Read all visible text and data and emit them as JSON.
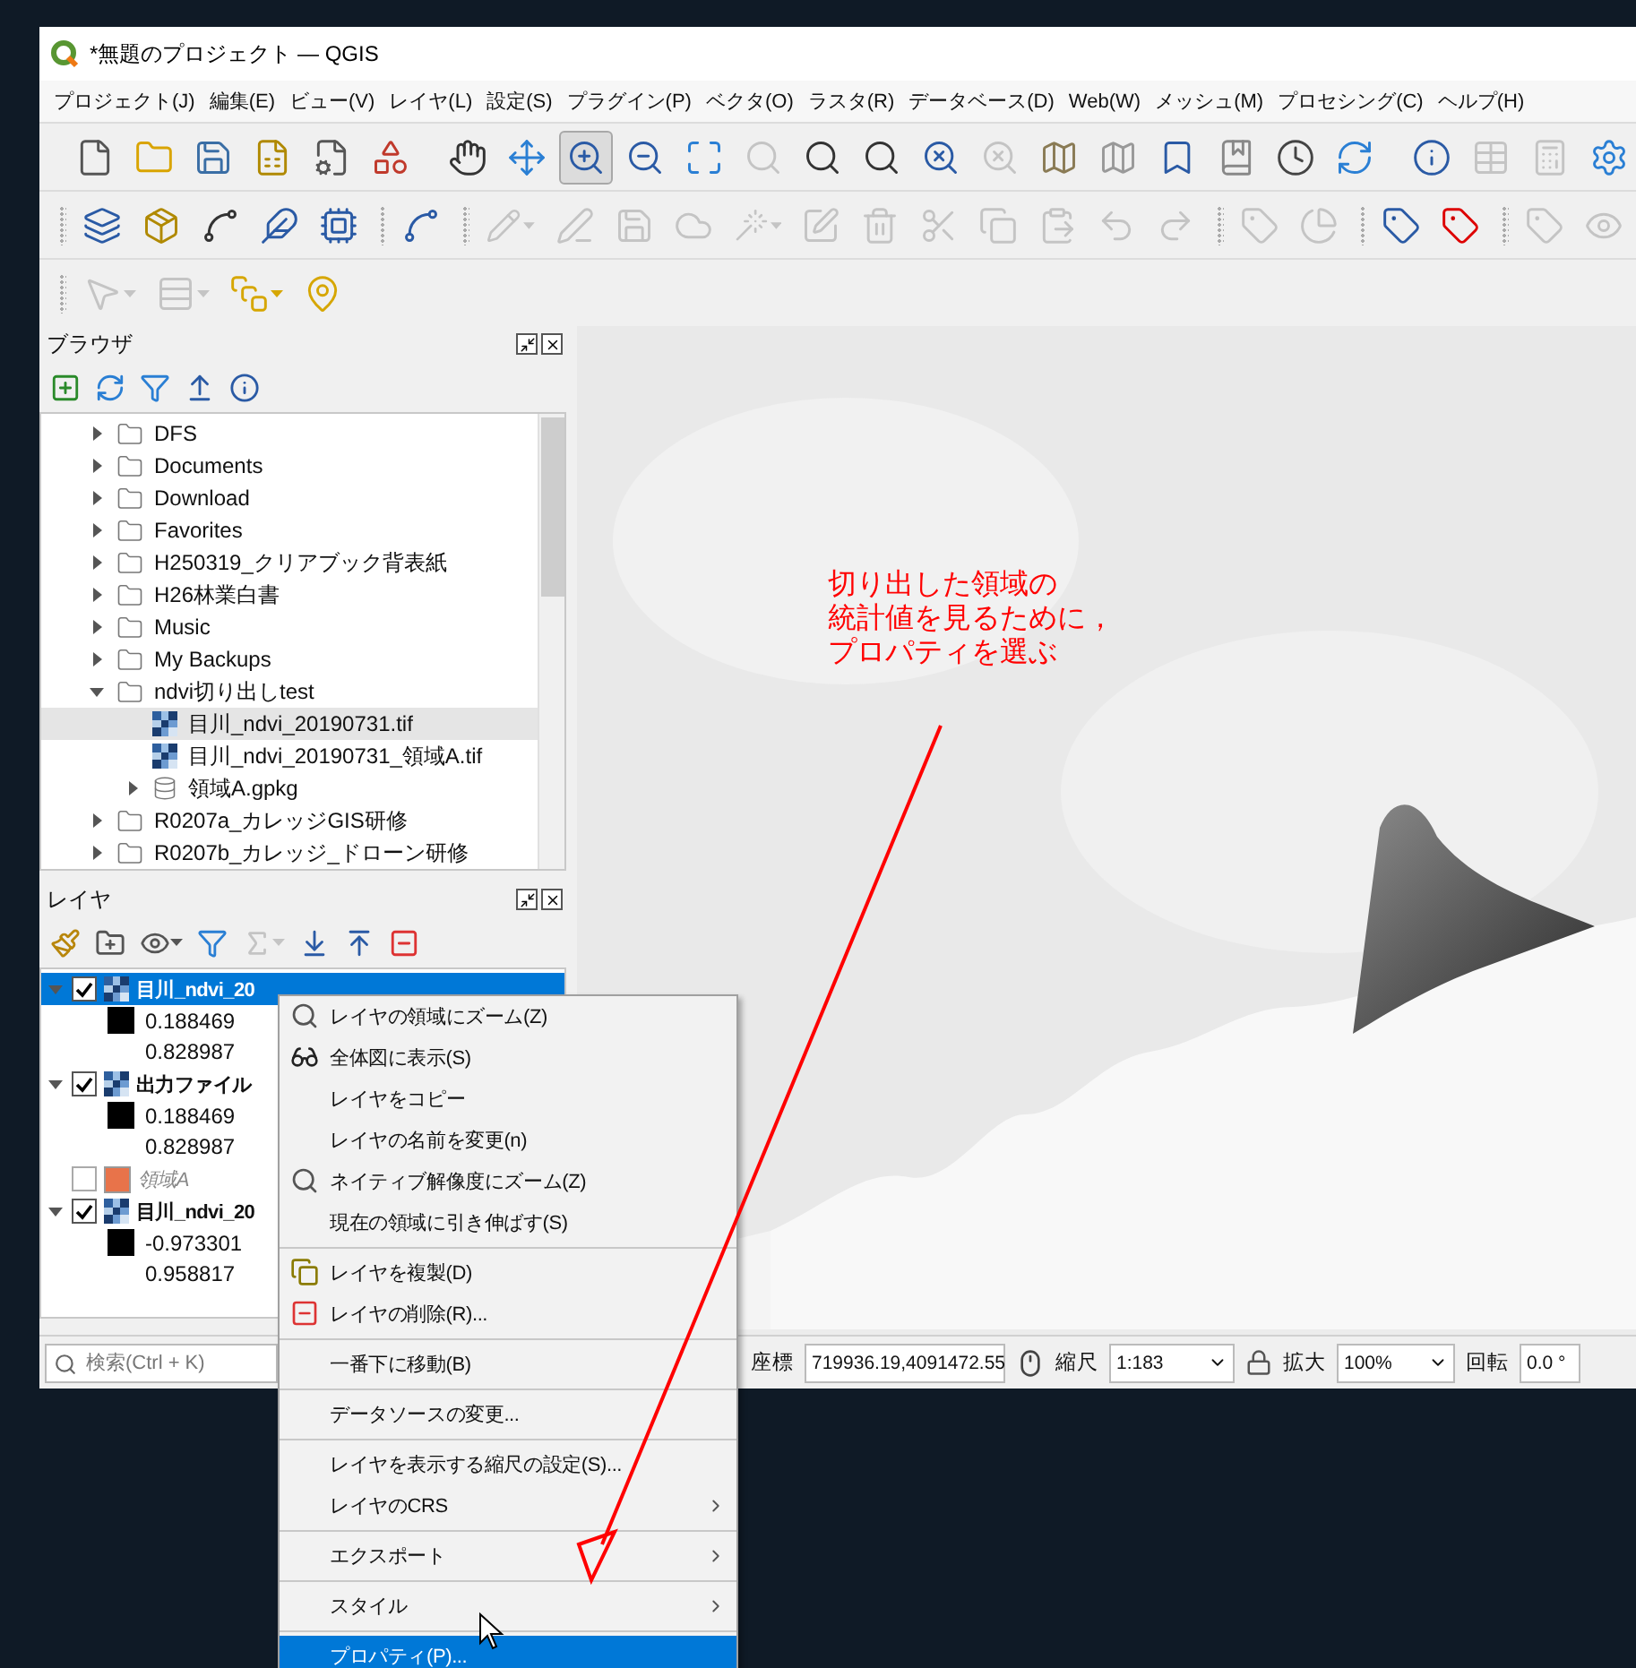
{
  "window": {
    "title": "*無題のプロジェクト — QGIS"
  },
  "menu_bar": [
    "プロジェクト(J)",
    "編集(E)",
    "ビュー(V)",
    "レイヤ(L)",
    "設定(S)",
    "プラグイン(P)",
    "ベクタ(O)",
    "ラスタ(R)",
    "データベース(D)",
    "Web(W)",
    "メッシュ(M)",
    "プロセシング(C)",
    "ヘルプ(H)"
  ],
  "toolbars": [
    {
      "buttons": [
        {
          "disabled": false,
          "selected": false
        },
        {
          "disabled": false,
          "selected": false
        },
        {
          "disabled": false,
          "selected": false
        },
        {
          "disabled": false,
          "selected": false
        },
        {
          "disabled": false,
          "selected": false
        },
        {
          "disabled": false,
          "selected": false
        },
        {
          "disabled": false,
          "selected": false
        },
        {
          "disabled": false,
          "selected": false
        },
        {
          "disabled": false,
          "selected": true
        },
        {
          "disabled": false,
          "selected": false
        },
        {
          "disabled": false,
          "selected": false
        },
        {
          "disabled": true,
          "selected": false
        },
        {
          "disabled": false,
          "selected": false
        },
        {
          "disabled": false,
          "selected": false
        },
        {
          "disabled": false,
          "selected": false
        },
        {
          "disabled": true,
          "selected": false
        },
        {
          "disabled": false,
          "selected": false
        },
        {
          "disabled": false,
          "selected": false
        },
        {
          "disabled": false,
          "selected": false
        },
        {
          "disabled": false,
          "selected": false
        },
        {
          "disabled": false,
          "selected": false
        },
        {
          "disabled": false,
          "selected": false
        },
        {
          "disabled": false,
          "selected": false
        },
        {
          "disabled": true,
          "selected": false
        },
        {
          "disabled": true,
          "selected": false
        },
        {
          "disabled": false,
          "selected": false
        }
      ]
    },
    {
      "buttons": [
        {
          "disabled": false,
          "selected": false
        },
        {
          "disabled": false,
          "selected": false
        },
        {
          "disabled": false,
          "selected": false
        },
        {
          "disabled": false,
          "selected": false
        },
        {
          "disabled": false,
          "selected": false
        },
        {
          "disabled": false,
          "selected": false
        },
        {
          "disabled": true,
          "selected": false
        },
        {
          "disabled": true,
          "selected": false
        },
        {
          "disabled": true,
          "selected": false
        },
        {
          "disabled": true,
          "selected": false
        },
        {
          "disabled": true,
          "selected": false
        },
        {
          "disabled": true,
          "selected": false
        },
        {
          "disabled": true,
          "selected": false
        },
        {
          "disabled": true,
          "selected": false
        },
        {
          "disabled": true,
          "selected": false
        },
        {
          "disabled": true,
          "selected": false
        },
        {
          "disabled": true,
          "selected": false
        },
        {
          "disabled": true,
          "selected": false
        },
        {
          "disabled": true,
          "selected": false
        },
        {
          "disabled": true,
          "selected": false
        },
        {
          "disabled": false,
          "selected": false
        },
        {
          "disabled": false,
          "selected": false
        },
        {
          "disabled": true,
          "selected": false
        },
        {
          "disabled": true,
          "selected": false
        }
      ]
    },
    {
      "buttons": [
        {
          "disabled": true,
          "selected": false
        },
        {
          "disabled": true,
          "selected": false
        },
        {
          "disabled": false,
          "selected": false
        },
        {
          "disabled": false,
          "selected": false
        }
      ]
    }
  ],
  "browser": {
    "title": "ブラウザ",
    "items": [
      {
        "label": "DFS",
        "kind": "folder",
        "expanded": false,
        "selected": false
      },
      {
        "label": "Documents",
        "kind": "folder",
        "expanded": false,
        "selected": false
      },
      {
        "label": "Download",
        "kind": "folder",
        "expanded": false,
        "selected": false
      },
      {
        "label": "Favorites",
        "kind": "folder",
        "expanded": false,
        "selected": false
      },
      {
        "label": "H250319_クリアブック背表紙",
        "kind": "folder",
        "expanded": false,
        "selected": false
      },
      {
        "label": "H26林業白書",
        "kind": "folder",
        "expanded": false,
        "selected": false
      },
      {
        "label": "Music",
        "kind": "folder",
        "expanded": false,
        "selected": false
      },
      {
        "label": "My Backups",
        "kind": "folder",
        "expanded": false,
        "selected": false
      },
      {
        "label": "ndvi切り出しtest",
        "kind": "folder",
        "expanded": true,
        "selected": false,
        "children": [
          {
            "label": "目川_ndvi_20190731.tif",
            "kind": "raster",
            "selected": true
          },
          {
            "label": "目川_ndvi_20190731_領域A.tif",
            "kind": "raster",
            "selected": false
          },
          {
            "label": "領域A.gpkg",
            "kind": "geopackage",
            "expanded": false,
            "selected": false
          }
        ]
      },
      {
        "label": "R0207a_カレッジGIS研修",
        "kind": "folder",
        "expanded": false,
        "selected": false
      },
      {
        "label": "R0207b_カレッジ_ドローン研修",
        "kind": "folder",
        "expanded": false,
        "selected": false
      }
    ]
  },
  "layers": {
    "title": "レイヤ",
    "toolbar": [
      {
        "disabled": false
      },
      {
        "disabled": false
      },
      {
        "disabled": false
      },
      {
        "disabled": false
      },
      {
        "disabled": true
      },
      {
        "disabled": false
      },
      {
        "disabled": false
      },
      {
        "disabled": false
      }
    ],
    "items": [
      {
        "name": "目川_ndvi_20",
        "kind": "raster",
        "checked": true,
        "selected": true,
        "expanded": true,
        "legend": [
          {
            "label": "0.188469",
            "color": "#000000"
          },
          {
            "label": "0.828987"
          }
        ]
      },
      {
        "name": "出力ファイル",
        "kind": "raster",
        "checked": true,
        "selected": false,
        "expanded": true,
        "legend": [
          {
            "label": "0.188469",
            "color": "#000000"
          },
          {
            "label": "0.828987"
          }
        ]
      },
      {
        "name": "領域A",
        "kind": "vector",
        "checked": false,
        "selected": false,
        "color": "#e8734a"
      },
      {
        "name": "目川_ndvi_20",
        "kind": "raster",
        "checked": true,
        "selected": false,
        "expanded": true,
        "legend": [
          {
            "label": "-0.973301",
            "color": "#000000"
          },
          {
            "label": "0.958817"
          }
        ]
      }
    ]
  },
  "annotation": {
    "lines": [
      "切り出した領域の",
      "統計値を見るために，",
      "プロパティを選ぶ"
    ]
  },
  "status_bar": {
    "search": {
      "placeholder": "検索(Ctrl + K)"
    },
    "coordinate": {
      "label": "座標",
      "value": "719936.19,4091472.55"
    },
    "scale": {
      "label": "縮尺",
      "value": "1:183"
    },
    "magnifier": {
      "label": "拡大",
      "value": "100%"
    },
    "rotation": {
      "label": "回転",
      "value": "0.0 °"
    }
  },
  "context_menu": {
    "groups": [
      [
        {
          "label": "レイヤの領域にズーム(Z)",
          "submenu": false,
          "selected": false
        },
        {
          "label": "全体図に表示(S)",
          "submenu": false,
          "selected": false
        },
        {
          "label": "レイヤをコピー",
          "submenu": false,
          "selected": false
        },
        {
          "label": "レイヤの名前を変更(n)",
          "submenu": false,
          "selected": false
        },
        {
          "label": "ネイティブ解像度にズーム(Z)",
          "submenu": false,
          "selected": false
        },
        {
          "label": "現在の領域に引き伸ばす(S)",
          "submenu": false,
          "selected": false
        }
      ],
      [
        {
          "label": "レイヤを複製(D)",
          "submenu": false,
          "selected": false
        },
        {
          "label": "レイヤの削除(R)...",
          "submenu": false,
          "selected": false
        }
      ],
      [
        {
          "label": "一番下に移動(B)",
          "submenu": false,
          "selected": false
        }
      ],
      [
        {
          "label": "データソースの変更...",
          "submenu": false,
          "selected": false
        }
      ],
      [
        {
          "label": "レイヤを表示する縮尺の設定(S)...",
          "submenu": false,
          "selected": false
        },
        {
          "label": "レイヤのCRS",
          "submenu": true,
          "selected": false
        }
      ],
      [
        {
          "label": "エクスポート",
          "submenu": true,
          "selected": false
        }
      ],
      [
        {
          "label": "スタイル",
          "submenu": true,
          "selected": false
        }
      ],
      [
        {
          "label": "プロパティ(P)...",
          "submenu": false,
          "selected": true
        }
      ]
    ]
  }
}
